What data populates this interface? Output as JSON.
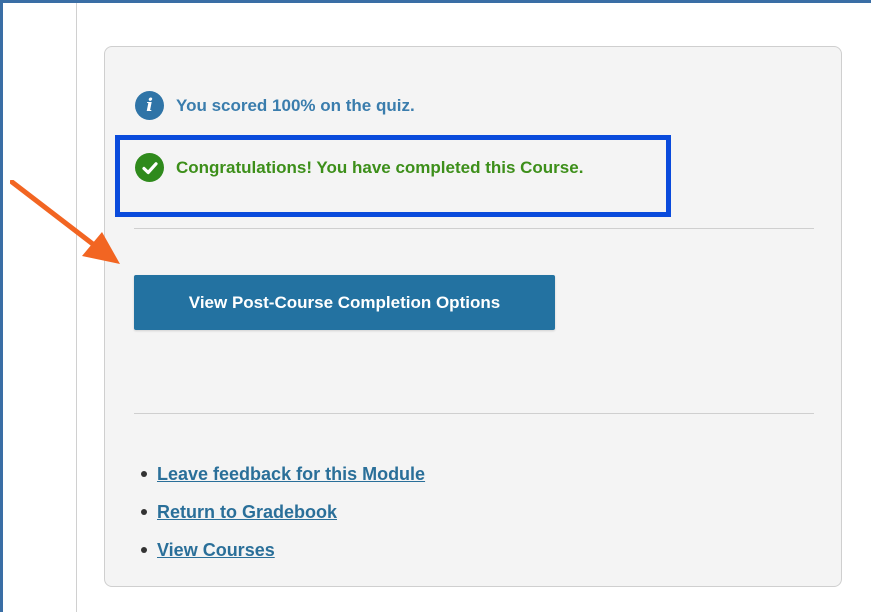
{
  "quiz_result": {
    "icon": "info-icon",
    "text": "You scored 100% on the quiz."
  },
  "completion": {
    "icon": "check-circle-icon",
    "text": "Congratulations! You have completed this Course."
  },
  "actions": {
    "post_course_button": "View Post-Course Completion Options"
  },
  "links": [
    {
      "label": "Leave feedback for this Module"
    },
    {
      "label": "Return to Gradebook"
    },
    {
      "label": "View Courses"
    }
  ],
  "colors": {
    "frame_border": "#3a6ea5",
    "info_text": "#3a7dad",
    "success_text": "#3d8f1a",
    "highlight_box": "#0a4bdc",
    "arrow": "#f26522",
    "button_bg": "#2372a1",
    "link": "#2a6f99"
  }
}
